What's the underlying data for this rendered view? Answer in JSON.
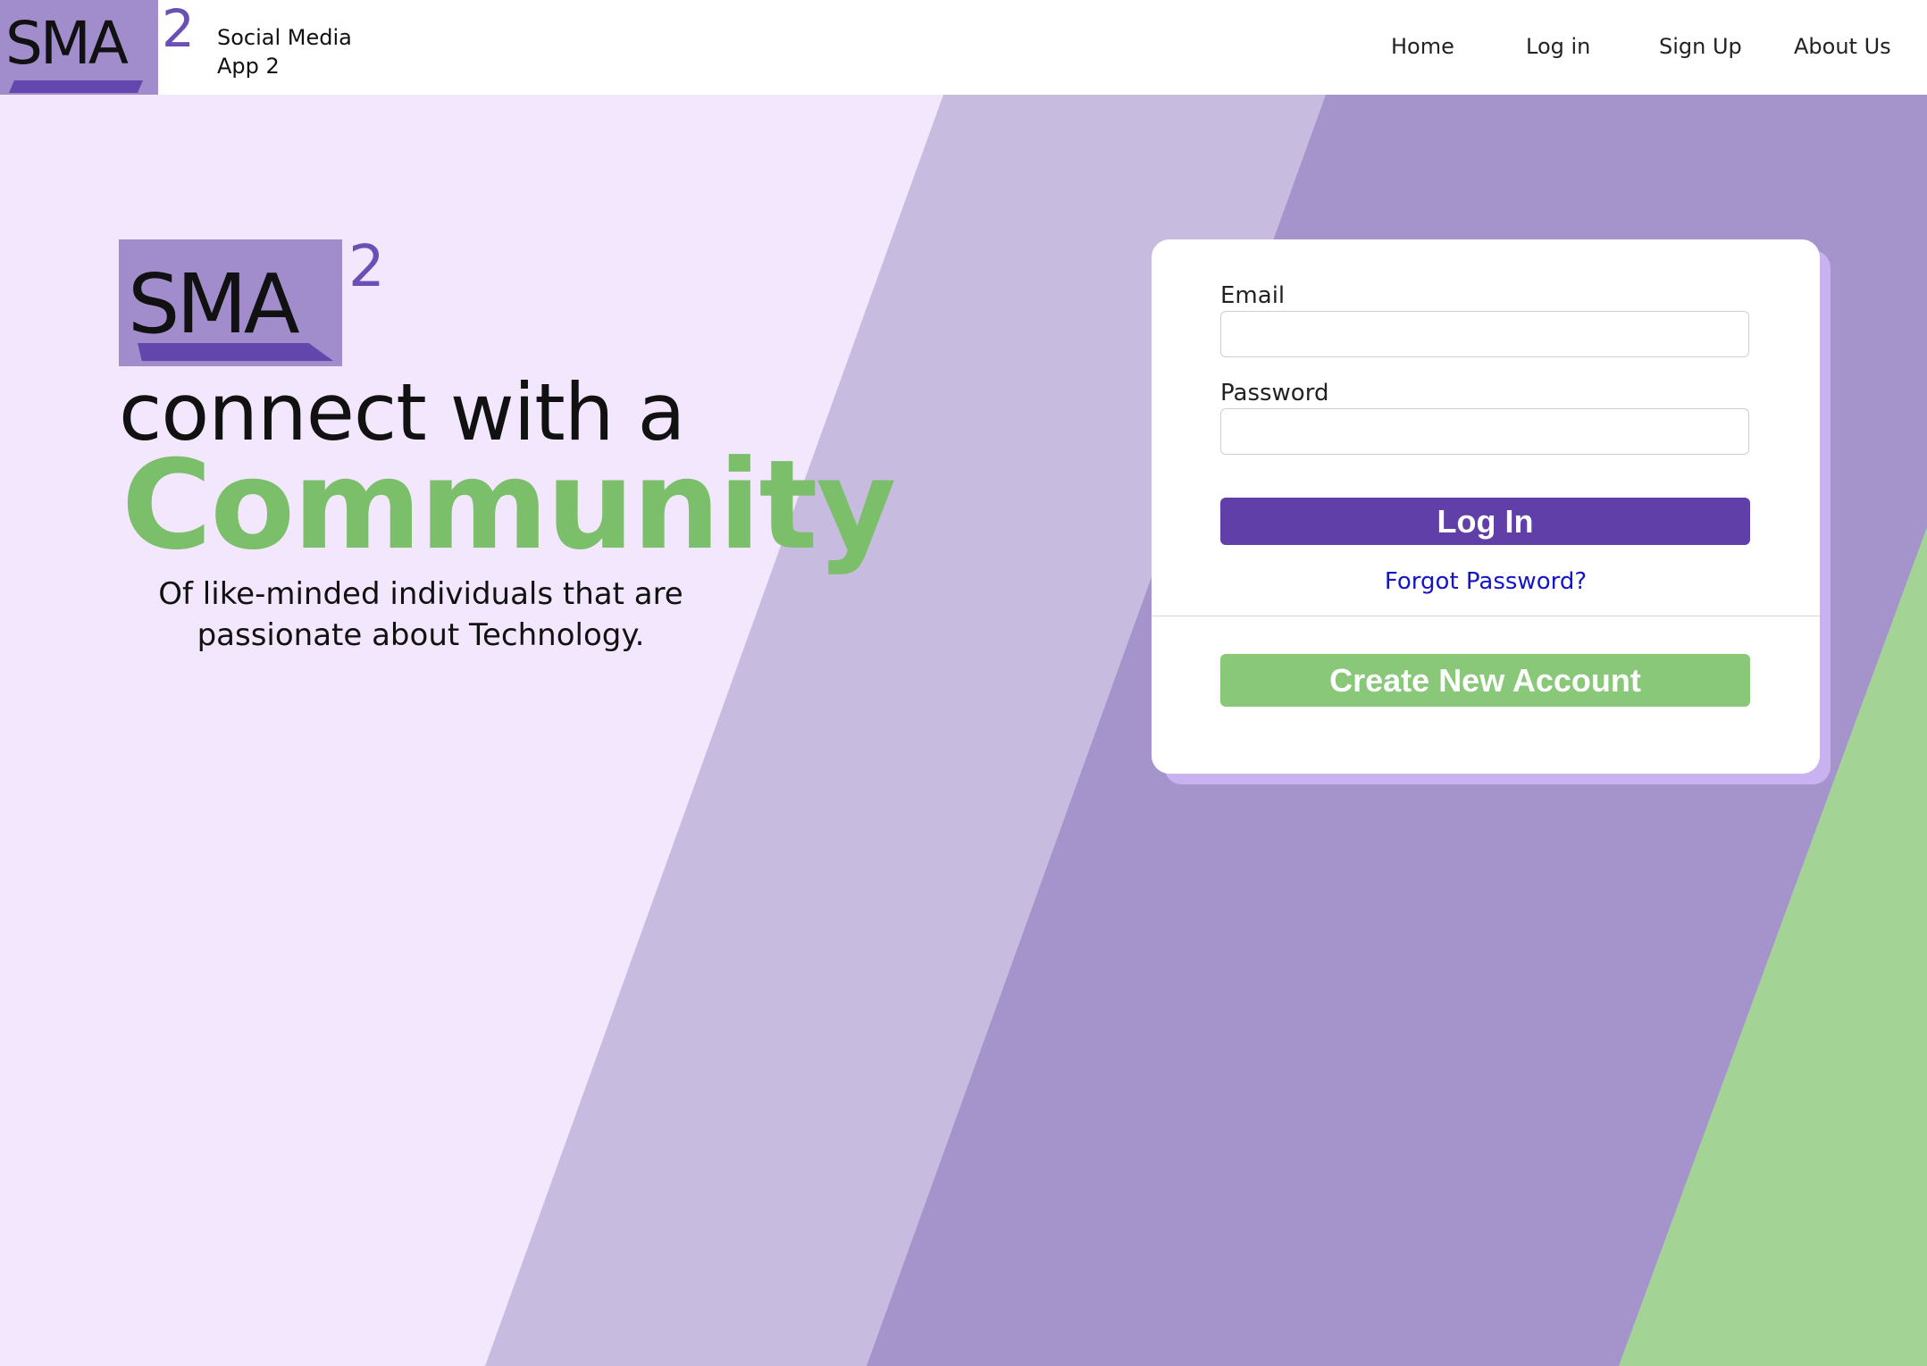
{
  "header": {
    "logo_text": "SMA",
    "logo_sup": "2",
    "app_name": "Social Media App 2",
    "nav": [
      {
        "label": "Home"
      },
      {
        "label": "Log in"
      },
      {
        "label": "Sign Up"
      },
      {
        "label": "About Us"
      }
    ]
  },
  "hero": {
    "logo_text": "SMA",
    "logo_sup": "2",
    "line1": "connect with a",
    "line2": "Community",
    "subtitle": "Of like-minded individuals that are passionate about Technology."
  },
  "login": {
    "email_label": "Email",
    "email_value": "",
    "password_label": "Password",
    "password_value": "",
    "login_button": "Log In",
    "forgot_link": "Forgot Password?",
    "create_button": "Create New Account"
  },
  "colors": {
    "brand_purple": "#6040a8",
    "logo_bg": "#a28dcc",
    "accent_green": "#7bbf6a",
    "button_green": "#88c878",
    "page_bg": "#f3e7fd",
    "link_blue": "#1414c8"
  }
}
